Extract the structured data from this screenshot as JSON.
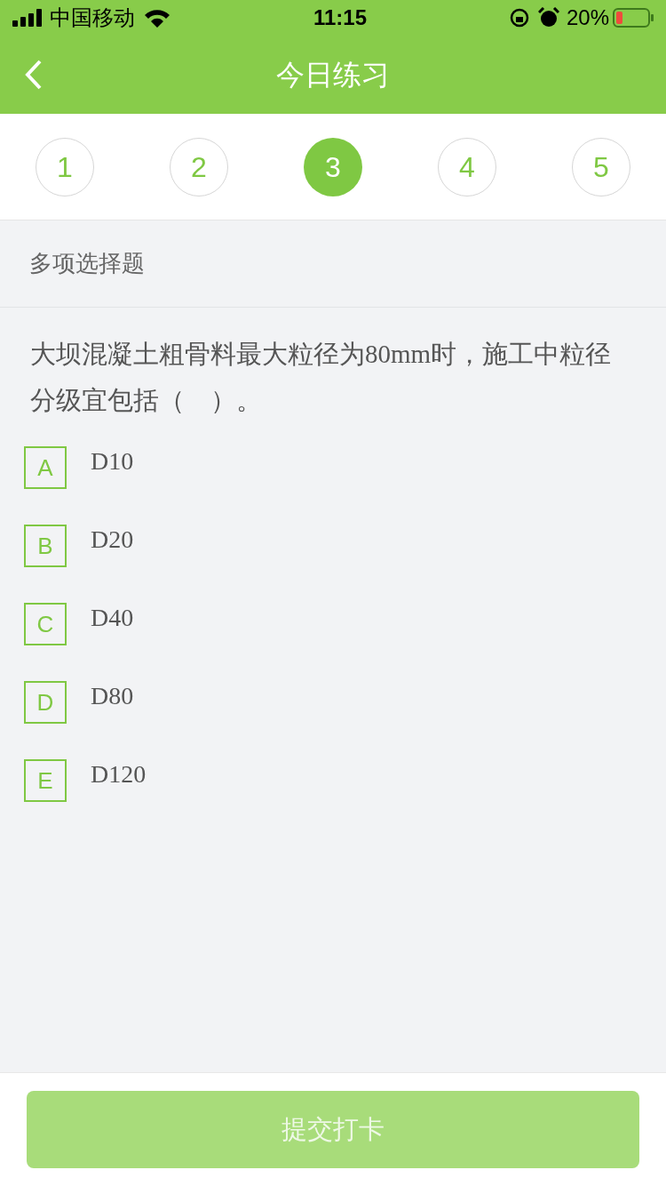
{
  "status_bar": {
    "carrier": "中国移动",
    "time": "11:15",
    "battery": "20%"
  },
  "nav": {
    "title": "今日练习"
  },
  "steps": [
    {
      "label": "1",
      "selected": false
    },
    {
      "label": "2",
      "selected": false
    },
    {
      "label": "3",
      "selected": true
    },
    {
      "label": "4",
      "selected": false
    },
    {
      "label": "5",
      "selected": false
    }
  ],
  "section": "多项选择题",
  "question": "大坝混凝土粗骨料最大粒径为80mm时，施工中粒径分级宜包括（　）。",
  "options": [
    {
      "letter": "A",
      "text": "D10",
      "selected": false
    },
    {
      "letter": "B",
      "text": "D20",
      "selected": false
    },
    {
      "letter": "C",
      "text": "D40",
      "selected": false
    },
    {
      "letter": "D",
      "text": "D80",
      "selected": false
    },
    {
      "letter": "E",
      "text": "D120",
      "selected": false
    }
  ],
  "submit": {
    "label": "提交打卡",
    "disabled": true
  }
}
